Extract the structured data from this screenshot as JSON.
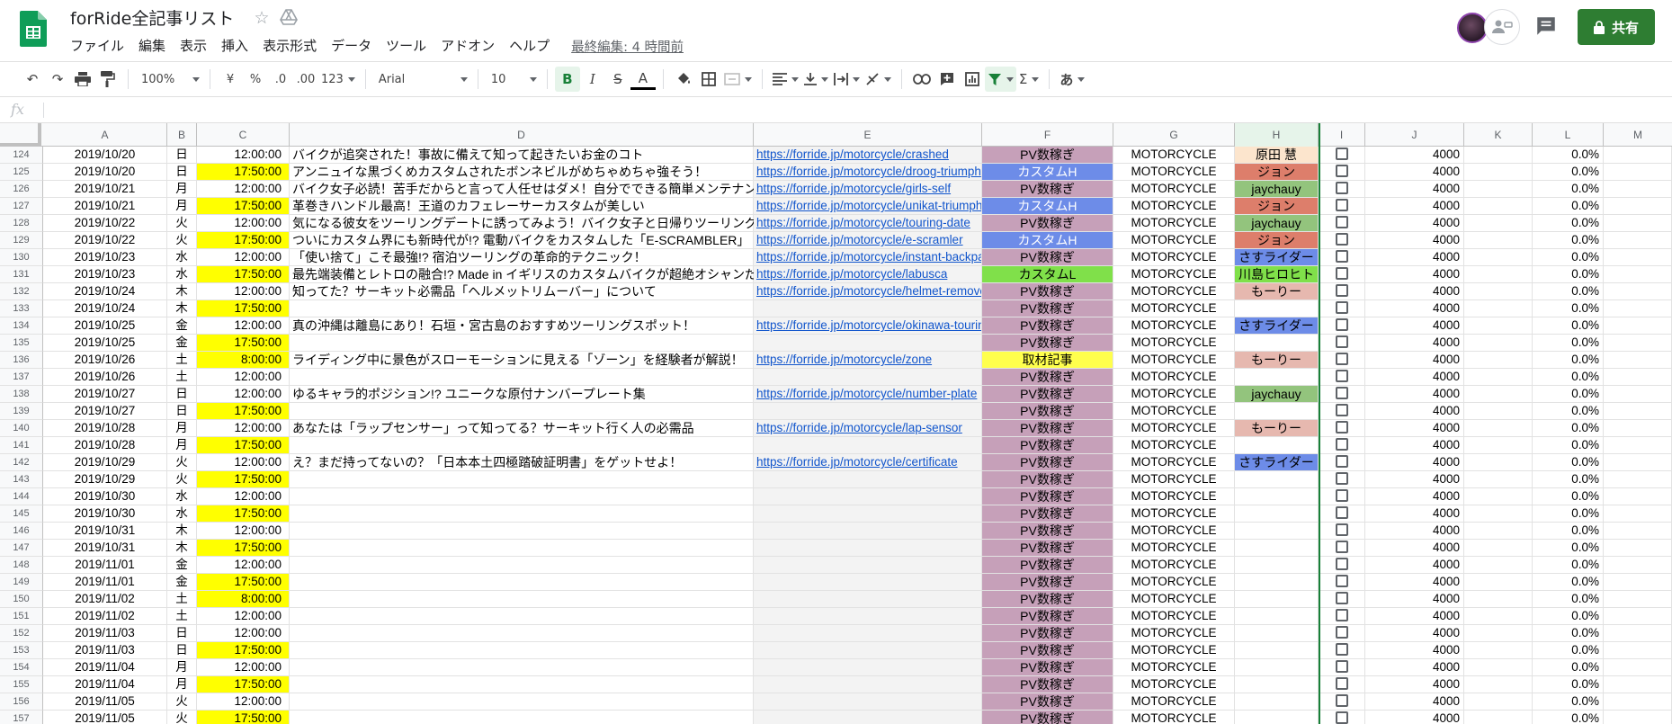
{
  "app": {
    "title": "forRide全記事リスト"
  },
  "menu": [
    "ファイル",
    "編集",
    "表示",
    "挿入",
    "表示形式",
    "データ",
    "ツール",
    "アドオン",
    "ヘルプ"
  ],
  "last_edit": "最終編集: 4 時間前",
  "share_label": "共有",
  "toolbar": {
    "zoom": "100%",
    "currency": "¥",
    "percent": "%",
    "dec_decrease": ".0",
    "dec_increase": ".00",
    "number_format": "123",
    "font": "Arial",
    "font_size": "10",
    "bold": "B",
    "italic": "I",
    "strike": "S",
    "text_color": "A",
    "sigma": "Σ",
    "ime": "あ"
  },
  "formula": {
    "label": "fx",
    "value": ""
  },
  "columns": [
    "A",
    "B",
    "C",
    "D",
    "E",
    "F",
    "G",
    "H",
    "I",
    "J",
    "K",
    "L",
    "M"
  ],
  "rows": [
    {
      "n": "124",
      "date": "2019/10/20",
      "dow": "日",
      "time": "12:00:00",
      "title": "バイクが追突された！事故に備えて知って起きたいお金のコト",
      "url": "https://forride.jp/motorcycle/crashed",
      "cat": "PV数稼ぎ",
      "g": "MOTORCYCLE",
      "author": "原田 慧",
      "j": "4000",
      "l": "0.0%"
    },
    {
      "n": "125",
      "date": "2019/10/20",
      "dow": "日",
      "time": "17:50:00",
      "title": "アンニュイな黒づくめカスタムされたボンネビルがめちゃめちゃ強そう！",
      "url": "https://forride.jp/motorcycle/droog-triumph",
      "cat": "カスタムH",
      "g": "MOTORCYCLE",
      "author": "ジョン",
      "j": "4000",
      "l": "0.0%"
    },
    {
      "n": "126",
      "date": "2019/10/21",
      "dow": "月",
      "time": "12:00:00",
      "title": "バイク女子必読！苦手だからと言って人任せはダメ！自分でできる簡単メンテナンス",
      "url": "https://forride.jp/motorcycle/girls-self",
      "cat": "PV数稼ぎ",
      "g": "MOTORCYCLE",
      "author": "jaychauy",
      "j": "4000",
      "l": "0.0%"
    },
    {
      "n": "127",
      "date": "2019/10/21",
      "dow": "月",
      "time": "17:50:00",
      "title": "革巻きハンドル最高！王道のカフェレーサーカスタムが美しい",
      "url": "https://forride.jp/motorcycle/unikat-triumph",
      "cat": "カスタムH",
      "g": "MOTORCYCLE",
      "author": "ジョン",
      "j": "4000",
      "l": "0.0%"
    },
    {
      "n": "128",
      "date": "2019/10/22",
      "dow": "火",
      "time": "12:00:00",
      "title": "気になる彼女をツーリングデートに誘ってみよう！バイク女子と日帰りツーリングデート",
      "url": "https://forride.jp/motorcycle/touring-date",
      "cat": "PV数稼ぎ",
      "g": "MOTORCYCLE",
      "author": "jaychauy",
      "j": "4000",
      "l": "0.0%"
    },
    {
      "n": "129",
      "date": "2019/10/22",
      "dow": "火",
      "time": "17:50:00",
      "title": "ついにカスタム界にも新時代が!? 電動バイクをカスタムした「E-SCRAMBLER」",
      "url": "https://forride.jp/motorcycle/e-scramler",
      "cat": "カスタムH",
      "g": "MOTORCYCLE",
      "author": "ジョン",
      "j": "4000",
      "l": "0.0%"
    },
    {
      "n": "130",
      "date": "2019/10/23",
      "dow": "水",
      "time": "12:00:00",
      "title": "「使い捨て」こそ最強!? 宿泊ツーリングの革命的テクニック！",
      "url": "https://forride.jp/motorcycle/instant-backpack",
      "cat": "PV数稼ぎ",
      "g": "MOTORCYCLE",
      "author": "さすライダー",
      "j": "4000",
      "l": "0.0%"
    },
    {
      "n": "131",
      "date": "2019/10/23",
      "dow": "水",
      "time": "17:50:00",
      "title": "最先端装備とレトロの融合!? Made in イギリスのカスタムバイクが超絶オシャンだ！",
      "url": "https://forride.jp/motorcycle/labusca",
      "cat": "カスタムL",
      "g": "MOTORCYCLE",
      "author": "川島ヒロヒト",
      "j": "4000",
      "l": "0.0%"
    },
    {
      "n": "132",
      "date": "2019/10/24",
      "dow": "木",
      "time": "12:00:00",
      "title": "知ってた？サーキット必需品「ヘルメットリムーバー」について",
      "url": "https://forride.jp/motorcycle/helmet-remover",
      "cat": "PV数稼ぎ",
      "g": "MOTORCYCLE",
      "author": "もーりー",
      "j": "4000",
      "l": "0.0%"
    },
    {
      "n": "133",
      "date": "2019/10/24",
      "dow": "木",
      "time": "17:50:00",
      "title": "",
      "url": "",
      "cat": "PV数稼ぎ",
      "g": "MOTORCYCLE",
      "author": "",
      "j": "4000",
      "l": "0.0%"
    },
    {
      "n": "134",
      "date": "2019/10/25",
      "dow": "金",
      "time": "12:00:00",
      "title": "真の沖縄は離島にあり！石垣・宮古島のおすすめツーリングスポット！",
      "url": "https://forride.jp/motorcycle/okinawa-touring",
      "cat": "PV数稼ぎ",
      "g": "MOTORCYCLE",
      "author": "さすライダー",
      "j": "4000",
      "l": "0.0%"
    },
    {
      "n": "135",
      "date": "2019/10/25",
      "dow": "金",
      "time": "17:50:00",
      "title": "",
      "url": "",
      "cat": "PV数稼ぎ",
      "g": "MOTORCYCLE",
      "author": "",
      "j": "4000",
      "l": "0.0%"
    },
    {
      "n": "136",
      "date": "2019/10/26",
      "dow": "土",
      "time": "8:00:00",
      "title": "ライディング中に景色がスローモーションに見える「ゾーン」を経験者が解説！",
      "url": "https://forride.jp/motorcycle/zone",
      "cat": "取材記事",
      "g": "MOTORCYCLE",
      "author": "もーりー",
      "j": "4000",
      "l": "0.0%"
    },
    {
      "n": "137",
      "date": "2019/10/26",
      "dow": "土",
      "time": "12:00:00",
      "title": "",
      "url": "",
      "cat": "PV数稼ぎ",
      "g": "MOTORCYCLE",
      "author": "",
      "j": "4000",
      "l": "0.0%"
    },
    {
      "n": "138",
      "date": "2019/10/27",
      "dow": "日",
      "time": "12:00:00",
      "title": "ゆるキャラ的ポジション!? ユニークな原付ナンバープレート集",
      "url": "https://forride.jp/motorcycle/number-plate",
      "cat": "PV数稼ぎ",
      "g": "MOTORCYCLE",
      "author": "jaychauy",
      "j": "4000",
      "l": "0.0%"
    },
    {
      "n": "139",
      "date": "2019/10/27",
      "dow": "日",
      "time": "17:50:00",
      "title": "",
      "url": "",
      "cat": "PV数稼ぎ",
      "g": "MOTORCYCLE",
      "author": "",
      "j": "4000",
      "l": "0.0%"
    },
    {
      "n": "140",
      "date": "2019/10/28",
      "dow": "月",
      "time": "12:00:00",
      "title": "あなたは「ラップセンサー」って知ってる？サーキット行く人の必需品",
      "url": "https://forride.jp/motorcycle/lap-sensor",
      "cat": "PV数稼ぎ",
      "g": "MOTORCYCLE",
      "author": "もーりー",
      "j": "4000",
      "l": "0.0%"
    },
    {
      "n": "141",
      "date": "2019/10/28",
      "dow": "月",
      "time": "17:50:00",
      "title": "",
      "url": "",
      "cat": "PV数稼ぎ",
      "g": "MOTORCYCLE",
      "author": "",
      "j": "4000",
      "l": "0.0%"
    },
    {
      "n": "142",
      "date": "2019/10/29",
      "dow": "火",
      "time": "12:00:00",
      "title": "え？まだ持ってないの？「日本本土四極踏破証明書」をゲットせよ！",
      "url": "https://forride.jp/motorcycle/certificate",
      "cat": "PV数稼ぎ",
      "g": "MOTORCYCLE",
      "author": "さすライダー",
      "j": "4000",
      "l": "0.0%"
    },
    {
      "n": "143",
      "date": "2019/10/29",
      "dow": "火",
      "time": "17:50:00",
      "title": "",
      "url": "",
      "cat": "PV数稼ぎ",
      "g": "MOTORCYCLE",
      "author": "",
      "j": "4000",
      "l": "0.0%"
    },
    {
      "n": "144",
      "date": "2019/10/30",
      "dow": "水",
      "time": "12:00:00",
      "title": "",
      "url": "",
      "cat": "PV数稼ぎ",
      "g": "MOTORCYCLE",
      "author": "",
      "j": "4000",
      "l": "0.0%"
    },
    {
      "n": "145",
      "date": "2019/10/30",
      "dow": "水",
      "time": "17:50:00",
      "title": "",
      "url": "",
      "cat": "PV数稼ぎ",
      "g": "MOTORCYCLE",
      "author": "",
      "j": "4000",
      "l": "0.0%"
    },
    {
      "n": "146",
      "date": "2019/10/31",
      "dow": "木",
      "time": "12:00:00",
      "title": "",
      "url": "",
      "cat": "PV数稼ぎ",
      "g": "MOTORCYCLE",
      "author": "",
      "j": "4000",
      "l": "0.0%"
    },
    {
      "n": "147",
      "date": "2019/10/31",
      "dow": "木",
      "time": "17:50:00",
      "title": "",
      "url": "",
      "cat": "PV数稼ぎ",
      "g": "MOTORCYCLE",
      "author": "",
      "j": "4000",
      "l": "0.0%"
    },
    {
      "n": "148",
      "date": "2019/11/01",
      "dow": "金",
      "time": "12:00:00",
      "title": "",
      "url": "",
      "cat": "PV数稼ぎ",
      "g": "MOTORCYCLE",
      "author": "",
      "j": "4000",
      "l": "0.0%"
    },
    {
      "n": "149",
      "date": "2019/11/01",
      "dow": "金",
      "time": "17:50:00",
      "title": "",
      "url": "",
      "cat": "PV数稼ぎ",
      "g": "MOTORCYCLE",
      "author": "",
      "j": "4000",
      "l": "0.0%"
    },
    {
      "n": "150",
      "date": "2019/11/02",
      "dow": "土",
      "time": "8:00:00",
      "title": "",
      "url": "",
      "cat": "PV数稼ぎ",
      "g": "MOTORCYCLE",
      "author": "",
      "j": "4000",
      "l": "0.0%"
    },
    {
      "n": "151",
      "date": "2019/11/02",
      "dow": "土",
      "time": "12:00:00",
      "title": "",
      "url": "",
      "cat": "PV数稼ぎ",
      "g": "MOTORCYCLE",
      "author": "",
      "j": "4000",
      "l": "0.0%"
    },
    {
      "n": "152",
      "date": "2019/11/03",
      "dow": "日",
      "time": "12:00:00",
      "title": "",
      "url": "",
      "cat": "PV数稼ぎ",
      "g": "MOTORCYCLE",
      "author": "",
      "j": "4000",
      "l": "0.0%"
    },
    {
      "n": "153",
      "date": "2019/11/03",
      "dow": "日",
      "time": "17:50:00",
      "title": "",
      "url": "",
      "cat": "PV数稼ぎ",
      "g": "MOTORCYCLE",
      "author": "",
      "j": "4000",
      "l": "0.0%"
    },
    {
      "n": "154",
      "date": "2019/11/04",
      "dow": "月",
      "time": "12:00:00",
      "title": "",
      "url": "",
      "cat": "PV数稼ぎ",
      "g": "MOTORCYCLE",
      "author": "",
      "j": "4000",
      "l": "0.0%"
    },
    {
      "n": "155",
      "date": "2019/11/04",
      "dow": "月",
      "time": "17:50:00",
      "title": "",
      "url": "",
      "cat": "PV数稼ぎ",
      "g": "MOTORCYCLE",
      "author": "",
      "j": "4000",
      "l": "0.0%"
    },
    {
      "n": "156",
      "date": "2019/11/05",
      "dow": "火",
      "time": "12:00:00",
      "title": "",
      "url": "",
      "cat": "PV数稼ぎ",
      "g": "MOTORCYCLE",
      "author": "",
      "j": "4000",
      "l": "0.0%"
    },
    {
      "n": "157",
      "date": "2019/11/05",
      "dow": "火",
      "time": "17:50:00",
      "title": "",
      "url": "",
      "cat": "PV数稼ぎ",
      "g": "MOTORCYCLE",
      "author": "",
      "j": "4000",
      "l": "0.0%"
    }
  ],
  "colors": {
    "cat_pv": "#c6a0b9",
    "cat_custom_h": "#6d8ce8",
    "cat_custom_l": "#80e04a",
    "cat_interview": "#ffff4d",
    "time_highlight": "#ffff00",
    "author_colors": {
      "原田 慧": "#fce5cd",
      "ジョン": "#dd7e6b",
      "jaychauy": "#93c47d",
      "さすライダー": "#6d8ce8",
      "川島ヒロヒト": "#80e04a",
      "もーりー": "#e6b8af"
    },
    "share_green": "#2e7d32",
    "link_blue": "#1155cc"
  }
}
